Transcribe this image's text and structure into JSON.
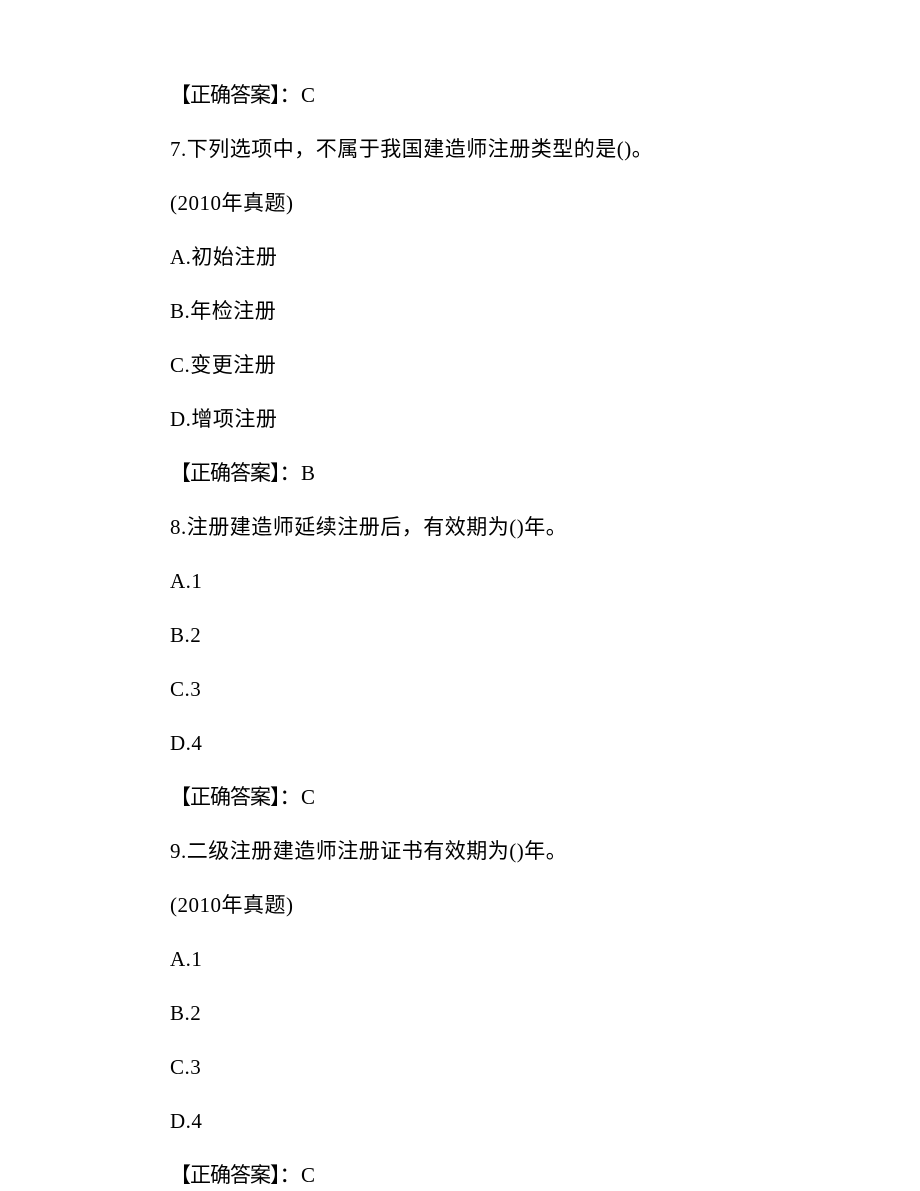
{
  "lines": [
    {
      "type": "answer",
      "label": "【正确答案】",
      "value": "：C"
    },
    {
      "type": "question",
      "text": "7.下列选项中，不属于我国建造师注册类型的是()。"
    },
    {
      "type": "note",
      "text": "(2010年真题)"
    },
    {
      "type": "option",
      "text": "A.初始注册"
    },
    {
      "type": "option",
      "text": "B.年检注册"
    },
    {
      "type": "option",
      "text": "C.变更注册"
    },
    {
      "type": "option",
      "text": "D.增项注册"
    },
    {
      "type": "answer",
      "label": "【正确答案】",
      "value": "：B"
    },
    {
      "type": "question",
      "text": "8.注册建造师延续注册后，有效期为()年。"
    },
    {
      "type": "option",
      "text": "A.1"
    },
    {
      "type": "option",
      "text": "B.2"
    },
    {
      "type": "option",
      "text": "C.3"
    },
    {
      "type": "option",
      "text": "D.4"
    },
    {
      "type": "answer",
      "label": "【正确答案】",
      "value": "：C"
    },
    {
      "type": "question",
      "text": "9.二级注册建造师注册证书有效期为()年。"
    },
    {
      "type": "note",
      "text": "(2010年真题)"
    },
    {
      "type": "option",
      "text": "A.1"
    },
    {
      "type": "option",
      "text": "B.2"
    },
    {
      "type": "option",
      "text": "C.3"
    },
    {
      "type": "option",
      "text": "D.4"
    },
    {
      "type": "answer",
      "label": "【正确答案】",
      "value": "：C"
    }
  ]
}
